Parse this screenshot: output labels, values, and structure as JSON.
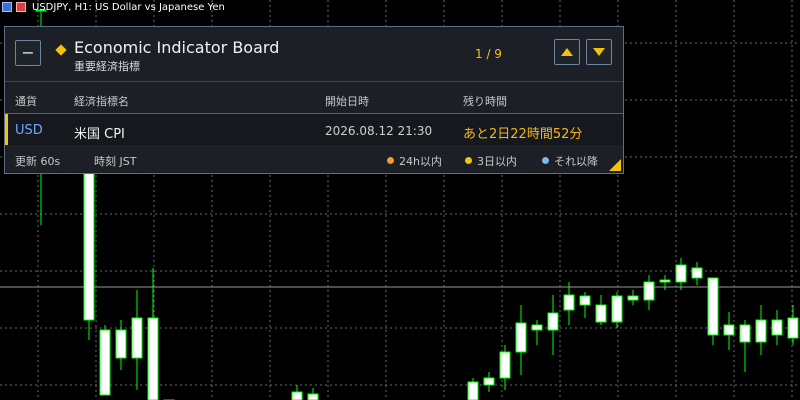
{
  "chart": {
    "title": "USDJPY, H1:  US Dollar vs Japanese Yen",
    "colors": {
      "background": "#000000",
      "grid": "#6a6a6a",
      "bull": "#00ff00",
      "body_fill": "#ffffff"
    }
  },
  "panel": {
    "title": "Economic Indicator Board",
    "subtitle": "重要経済指標",
    "page": "1 / 9",
    "minimize_label": "−",
    "columns": {
      "currency": "通貨",
      "name": "経済指標名",
      "start": "開始日時",
      "remaining": "残り時間"
    },
    "rows": [
      {
        "currency": "USD",
        "name": "米国 CPI",
        "start": "2026.08.12 21:30",
        "remaining": "あと2日22時間52分"
      }
    ],
    "footer": {
      "update": "更新 60s",
      "timezone": "時刻 JST",
      "legend": [
        {
          "label": "24h以内",
          "color": "#f39c2a"
        },
        {
          "label": "3日以内",
          "color": "#f4c20d"
        },
        {
          "label": "それ以降",
          "color": "#7fb6ee"
        }
      ]
    },
    "colors": {
      "accent": "#f4c20d",
      "currency": "#6fa8ff",
      "remaining": "#f4b81a",
      "border": "#5a6f8c"
    }
  }
}
